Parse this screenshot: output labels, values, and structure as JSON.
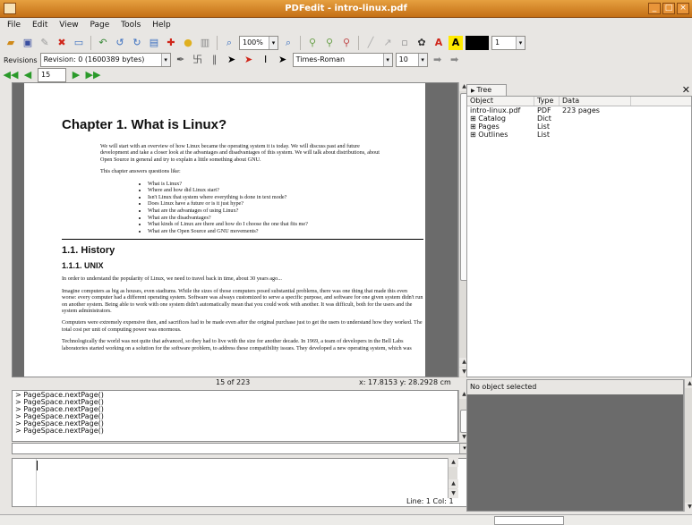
{
  "window": {
    "title": "PDFedit - intro-linux.pdf"
  },
  "menu": [
    "File",
    "Edit",
    "View",
    "Page",
    "Tools",
    "Help"
  ],
  "toolbar1": {
    "zoom": "100%",
    "fg_color_count": "1"
  },
  "toolbar2": {
    "revisions_label": "Revisions",
    "revision_value": "Revision: 0 (1600389 bytes)",
    "font": "Times-Roman",
    "size": "10"
  },
  "toolbar3": {
    "page_number": "15"
  },
  "doc": {
    "chapter": "Chapter 1. What is Linux?",
    "intro": "We will start with an overview of how Linux became the operating system it is today. We will discuss past and future development and take a closer look at the advantages and disadvantages of this system. We will talk about distributions, about Open Source in general and try to explain a little something about GNU.",
    "answers": "This chapter answers questions like:",
    "bullets": [
      "What is Linux?",
      "Where and how did Linux start?",
      "Isn't Linux that system where everything is done in text mode?",
      "Does Linux have a future or is it just hype?",
      "What are the advantages of using Linux?",
      "What are the disadvantages?",
      "What kinds of Linux are there and how do I choose the one that fits me?",
      "What are the Open Source and GNU movements?"
    ],
    "h_history": "1.1. History",
    "h_unix": "1.1.1. UNIX",
    "p1": "In order to understand the popularity of Linux, we need to travel back in time, about 30 years ago...",
    "p2": "Imagine computers as big as houses, even stadiums. While the sizes of those computers posed substantial problems, there was one thing that made this even worse: every computer had a different operating system. Software was always customized to serve a specific purpose, and software for one given system didn't run on another system. Being able to work with one system didn't automatically mean that you could work with another. It was difficult, both for the users and the system administrators.",
    "p3": "Computers were extremely expensive then, and sacrifices had to be made even after the original purchase just to get the users to understand how they worked. The total cost per unit of computing power was enormous.",
    "p4": "Technologically the world was not quite that advanced, so they had to live with the size for another decade. In 1969, a team of developers in the Bell Labs laboratories started working on a solution for the software problem, to address these compatibility issues. They developed a new operating system, which was"
  },
  "status": {
    "page": "15 of 223",
    "coords": "x: 17.8153 y: 28.2928 cm"
  },
  "console": [
    "> PageSpace.nextPage()",
    "> PageSpace.nextPage()",
    "> PageSpace.nextPage()",
    "> PageSpace.nextPage()",
    "> PageSpace.nextPage()",
    "> PageSpace.nextPage()"
  ],
  "editor": {
    "linecol": "Line: 1 Col: 1"
  },
  "tree": {
    "tab": "Tree",
    "headers": [
      "Object",
      "Type",
      "Data"
    ],
    "rows": [
      {
        "obj": "intro-linux.pdf",
        "type": "PDF",
        "data": "223 pages"
      },
      {
        "obj": "⊞ Catalog",
        "type": "Dict",
        "data": ""
      },
      {
        "obj": "⊞ Pages",
        "type": "List",
        "data": ""
      },
      {
        "obj": "⊞ Outlines",
        "type": "List",
        "data": ""
      }
    ]
  },
  "props": {
    "empty": "No object selected"
  }
}
